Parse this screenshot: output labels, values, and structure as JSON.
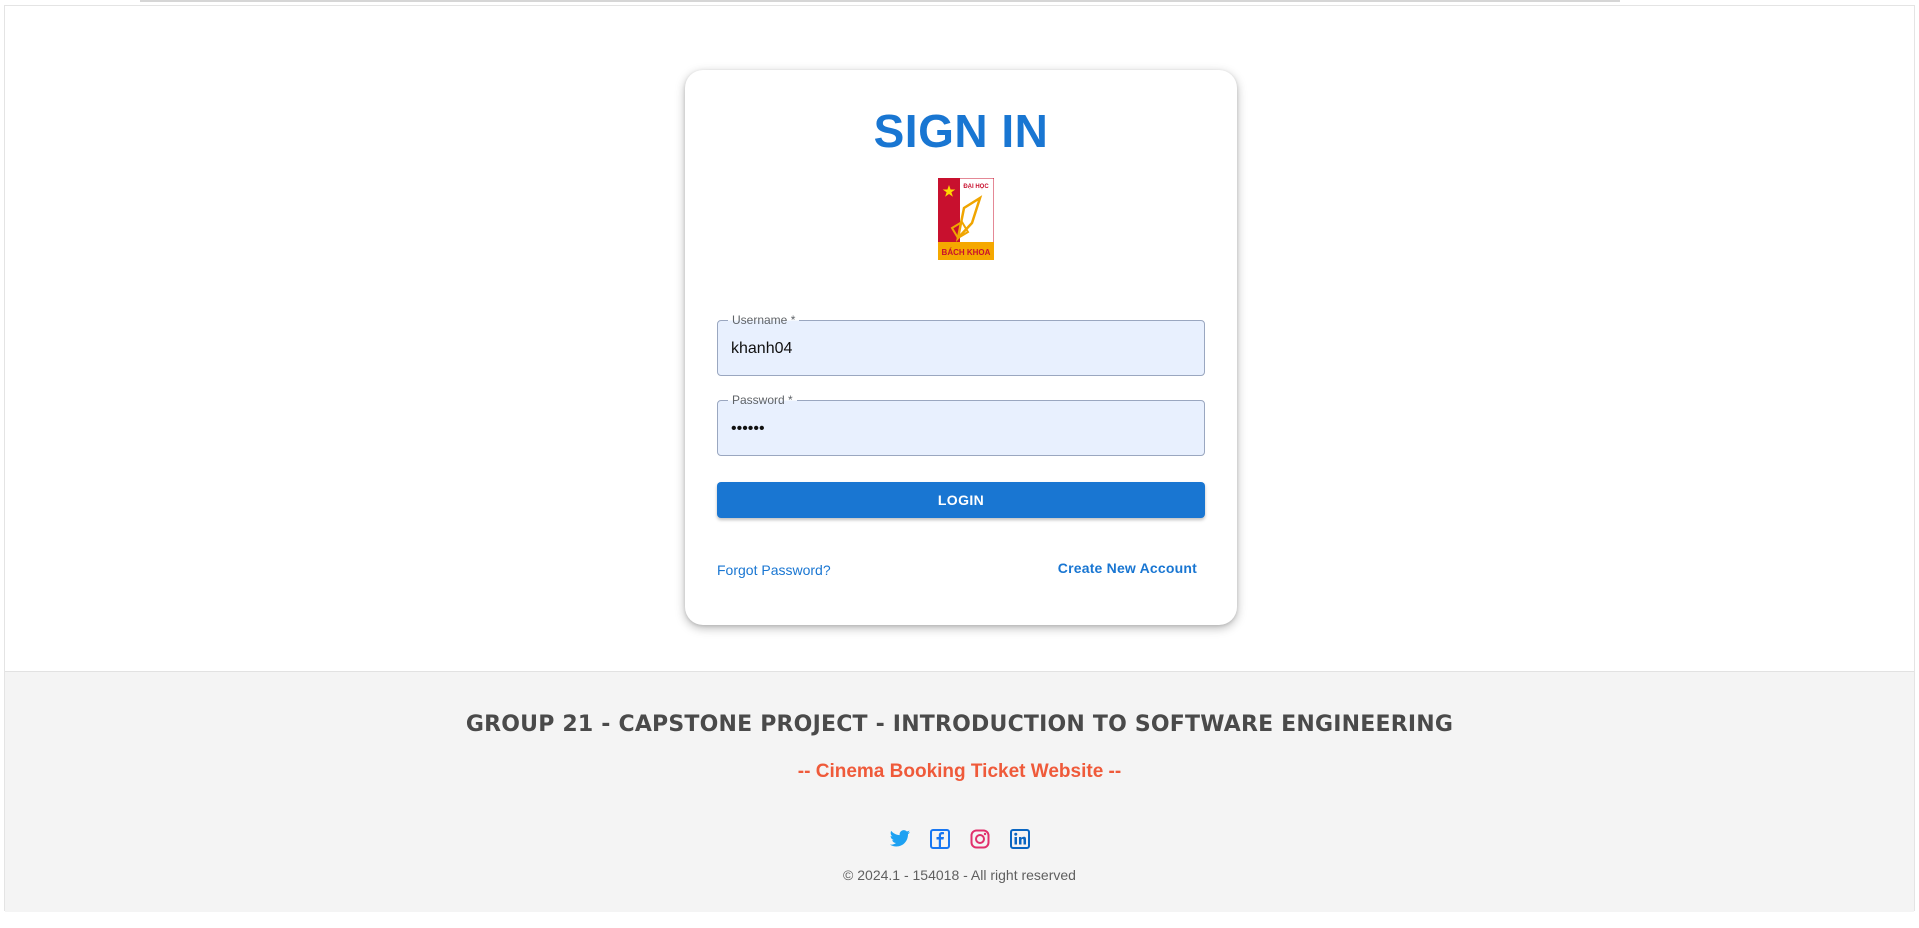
{
  "login": {
    "title": "SIGN IN",
    "logo": {
      "name": "bach-khoa-logo",
      "top_text": "ĐẠI HỌC",
      "bottom_text": "BÁCH KHOA"
    },
    "username": {
      "label": "Username *",
      "value": "khanh04"
    },
    "password": {
      "label": "Password *",
      "value": "••••••"
    },
    "login_button": "LOGIN",
    "forgot_link": "Forgot Password?",
    "create_link": "Create New Account"
  },
  "footer": {
    "title": "GROUP 21 - CAPSTONE PROJECT - INTRODUCTION TO SOFTWARE ENGINEERING",
    "subtitle": "-- Cinema Booking Ticket Website --",
    "socials": [
      "twitter-icon",
      "facebook-icon",
      "instagram-icon",
      "linkedin-icon"
    ],
    "copyright": "© 2024.1 - 154018 - All right reserved"
  },
  "colors": {
    "primary": "#1976d2",
    "footer_subtitle": "#ef5a3a",
    "twitter": "#1da1f2",
    "facebook": "#1877f2",
    "instagram": "#e1306c",
    "linkedin": "#0a66c2"
  }
}
